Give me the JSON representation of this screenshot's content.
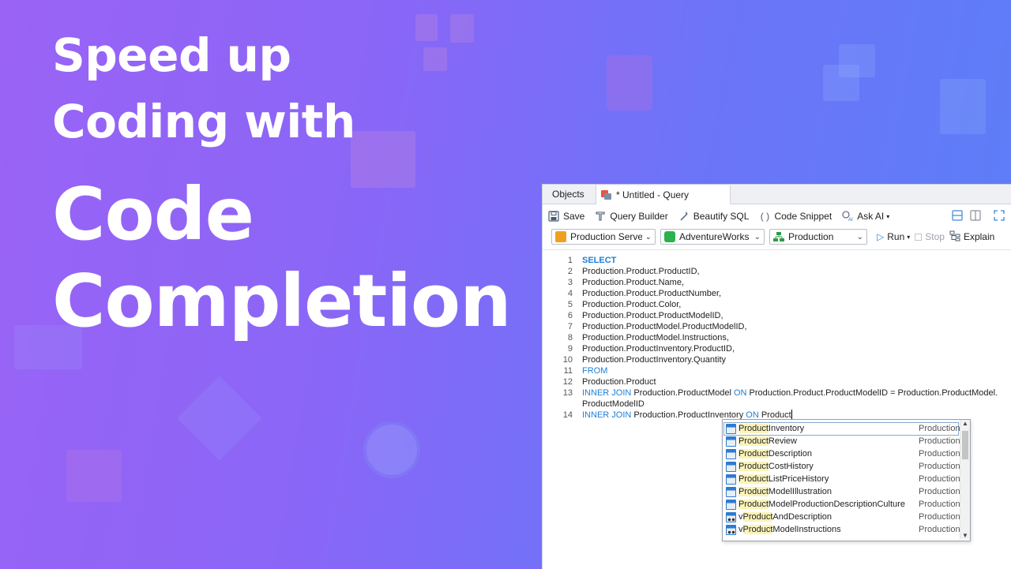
{
  "headline": {
    "line1": "Speed up",
    "line2": "Coding with",
    "line3": "Code",
    "line4": "Completion"
  },
  "tabs": {
    "objects": "Objects",
    "query": "* Untitled - Query"
  },
  "toolbar": {
    "save": "Save",
    "query_builder": "Query Builder",
    "beautify": "Beautify SQL",
    "snippet": "Code Snippet",
    "ask_ai": "Ask AI"
  },
  "connection": {
    "server": "Production Server",
    "database": "AdventureWorks",
    "schema": "Production",
    "run": "Run",
    "stop": "Stop",
    "explain": "Explain"
  },
  "editor": {
    "lines": [
      {
        "n": "1",
        "text": ""
      },
      {
        "n": "2",
        "text": "Production.Product.ProductID,"
      },
      {
        "n": "3",
        "text": "Production.Product.Name,"
      },
      {
        "n": "4",
        "text": "Production.Product.ProductNumber,"
      },
      {
        "n": "5",
        "text": "Production.Product.Color,"
      },
      {
        "n": "6",
        "text": "Production.Product.ProductModelID,"
      },
      {
        "n": "7",
        "text": "Production.ProductModel.ProductModelID,"
      },
      {
        "n": "8",
        "text": "Production.ProductModel.Instructions,"
      },
      {
        "n": "9",
        "text": "Production.ProductInventory.ProductID,"
      },
      {
        "n": "10",
        "text": "Production.ProductInventory.Quantity"
      },
      {
        "n": "11",
        "text": ""
      },
      {
        "n": "12",
        "text": "Production.Product"
      },
      {
        "n": "13",
        "text": ""
      },
      {
        "n": "14",
        "text": ""
      }
    ],
    "kw_select": "SELECT",
    "kw_from": "FROM",
    "kw_inner_join": "INNER JOIN",
    "kw_on": "ON",
    "l13_a": " Production.ProductModel ",
    "l13_b": " Production.Product.ProductModelID = Production.ProductModel.",
    "l13_wrap": "ProductModelID",
    "l14_a": " Production.ProductInventory ",
    "l14_b": " Product"
  },
  "completion": {
    "prefix": "Product",
    "items": [
      {
        "rest": "Inventory",
        "schema": "Production",
        "kind": "table"
      },
      {
        "rest": "Review",
        "schema": "Production",
        "kind": "table"
      },
      {
        "rest": "Description",
        "schema": "Production",
        "kind": "table"
      },
      {
        "rest": "CostHistory",
        "schema": "Production",
        "kind": "table"
      },
      {
        "rest": "ListPriceHistory",
        "schema": "Production",
        "kind": "table"
      },
      {
        "rest": "ModelIllustration",
        "schema": "Production",
        "kind": "table"
      },
      {
        "rest": "ModelProductionDescriptionCulture",
        "schema": "Production",
        "kind": "table"
      },
      {
        "pre": "v",
        "rest": "AndDescription",
        "schema": "Production",
        "kind": "view"
      },
      {
        "pre": "v",
        "rest": "ModelInstructions",
        "schema": "Production",
        "kind": "view"
      }
    ]
  },
  "colors": {
    "keyword": "#1e7fd6",
    "highlight": "#fbf3b8",
    "bg_start": "#9a63f5",
    "bg_end": "#5b7ff7"
  }
}
